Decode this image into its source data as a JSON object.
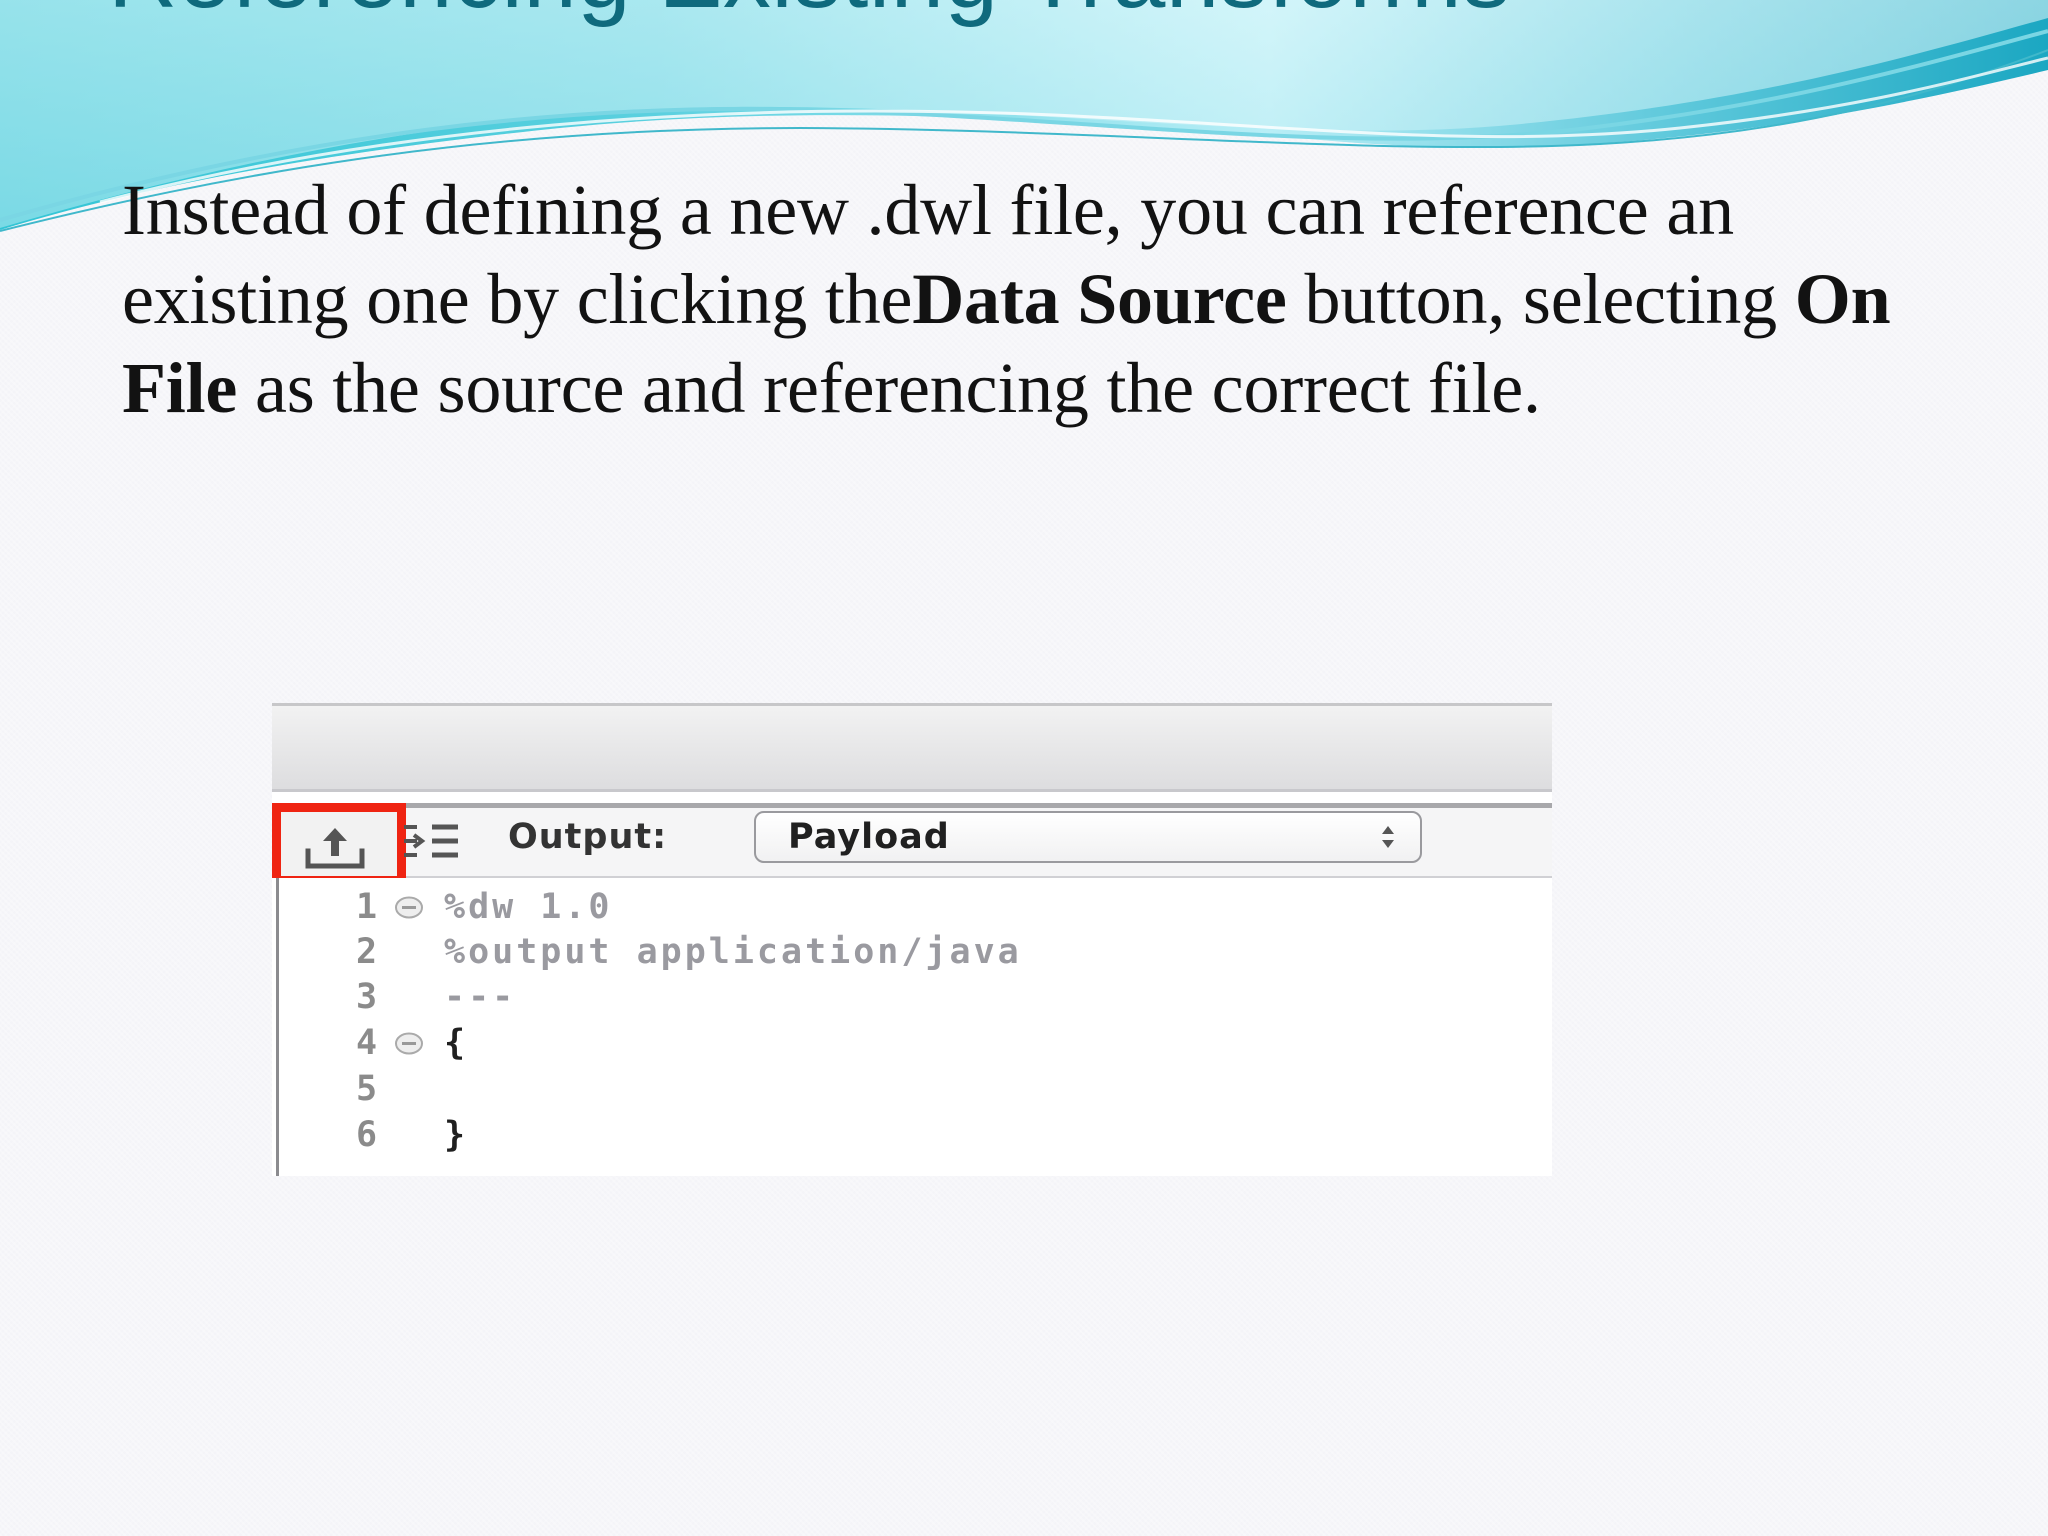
{
  "slide": {
    "title": "Referencing Existing Transforms",
    "body": {
      "part1": "Instead of defining a new .dwl file, you can reference an existing one by clicking the",
      "bold1": "Data Source",
      "part2": " button, selecting ",
      "bold2": "On File",
      "part3": " as the source and referencing the correct file."
    }
  },
  "screenshot": {
    "toolbar": {
      "data_source_icon": "upload-icon",
      "outline_icon": "outline-list-icon",
      "output_label": "Output:",
      "output_value": "Payload"
    },
    "editor": {
      "lines": [
        {
          "number": "1",
          "text": "%dw 1.0",
          "fold": true
        },
        {
          "number": "2",
          "text": "%output application/java",
          "fold": false
        },
        {
          "number": "3",
          "text": "---",
          "fold": false
        },
        {
          "number": "4",
          "text": "{",
          "fold": true
        },
        {
          "number": "5",
          "text": "",
          "fold": false
        },
        {
          "number": "6",
          "text": "}",
          "fold": false
        }
      ]
    }
  },
  "colors": {
    "title": "#0f6a7d",
    "highlight_box": "#ef2412",
    "banner_teal": "#37bfd0",
    "banner_light": "#d3f3f9"
  }
}
